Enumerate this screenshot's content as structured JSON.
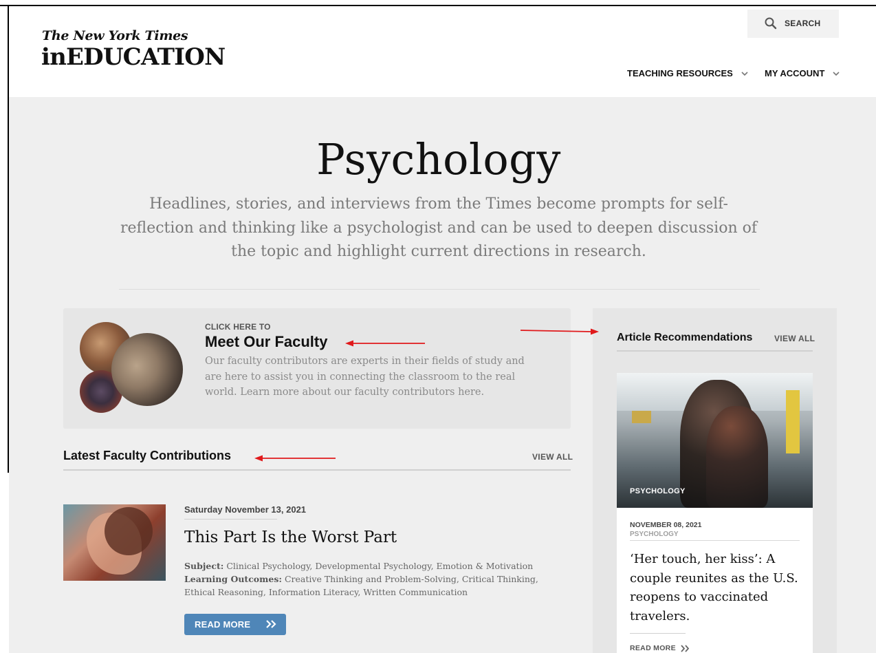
{
  "header": {
    "logo_top": "The New York Times",
    "logo_main": "inEDUCATION",
    "search_label": "SEARCH",
    "nav": [
      {
        "label": "TEACHING RESOURCES"
      },
      {
        "label": "MY ACCOUNT"
      }
    ]
  },
  "hero": {
    "title": "Psychology",
    "description": "Headlines, stories, and interviews from the Times become prompts for self-reflection and thinking like a psychologist and can be used to deepen discussion of the topic and highlight current directions in research."
  },
  "faculty": {
    "pre_label": "CLICK HERE TO",
    "title": "Meet Our Faculty",
    "body": "Our faculty contributors are experts in their fields of study and are here to assist you in connecting the classroom to the real world. Learn more about our faculty contributors here."
  },
  "latest": {
    "title": "Latest Faculty Contributions",
    "view_all": "VIEW ALL",
    "item": {
      "date": "Saturday November 13, 2021",
      "title": "This Part Is the Worst Part",
      "subject_label": "Subject:",
      "subject": "Clinical Psychology, Developmental Psychology, Emotion & Motivation",
      "outcomes_label": "Learning Outcomes:",
      "outcomes": "Creative Thinking and Problem-Solving, Critical Thinking, Ethical Reasoning, Information Literacy, Written Communication",
      "read_more": "READ MORE"
    }
  },
  "recommendations": {
    "title": "Article Recommendations",
    "view_all": "VIEW ALL",
    "card": {
      "image_tag": "PSYCHOLOGY",
      "date": "NOVEMBER 08, 2021",
      "category": "PSYCHOLOGY",
      "headline": "‘Her touch, her kiss’: A couple reunites as the U.S. reopens to vaccinated travelers.",
      "read_more": "READ MORE"
    }
  },
  "colors": {
    "accent_button": "#4f86b8",
    "annotation_arrow": "#e0191b",
    "page_gray": "#efefef"
  }
}
